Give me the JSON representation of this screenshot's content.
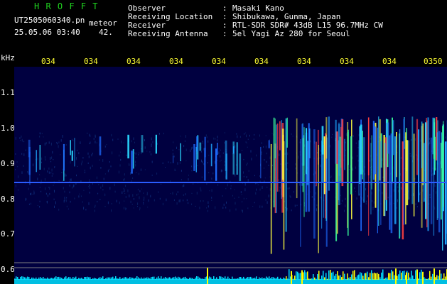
{
  "header": {
    "logo": "H R O F F T",
    "file": "UT2505060340.pn",
    "category": "meteor",
    "datetime": "25.05.06 03:40",
    "count": "42.",
    "fields": [
      {
        "label": "Observer",
        "value": "Masaki Kano"
      },
      {
        "label": "Receiving Location",
        "value": "Shibukawa, Gunma, Japan"
      },
      {
        "label": "Receiver",
        "value": "RTL-SDR SDR# 43dB L15 96.7MHz CW"
      },
      {
        "label": "Receiving Antenna",
        "value": "5el Yagi Az 280 for Seoul"
      }
    ],
    "separator": ":"
  },
  "axis": {
    "unit": "kHz",
    "y_ticks": [
      "1.1",
      "1.0",
      "0.9",
      "0.8",
      "0.7",
      "0.6"
    ],
    "x_ticks": [
      "034",
      "034",
      "034",
      "034",
      "034",
      "034",
      "034",
      "034",
      "034",
      "0350"
    ]
  },
  "colors": {
    "background": "#000000",
    "spectrum_bg": "#000040",
    "logo": "#1fd21f",
    "time_labels": "#ffff33",
    "carrier": "#2a5cff",
    "baseline": "#00e0ff",
    "peaks": "#ffff00"
  }
}
